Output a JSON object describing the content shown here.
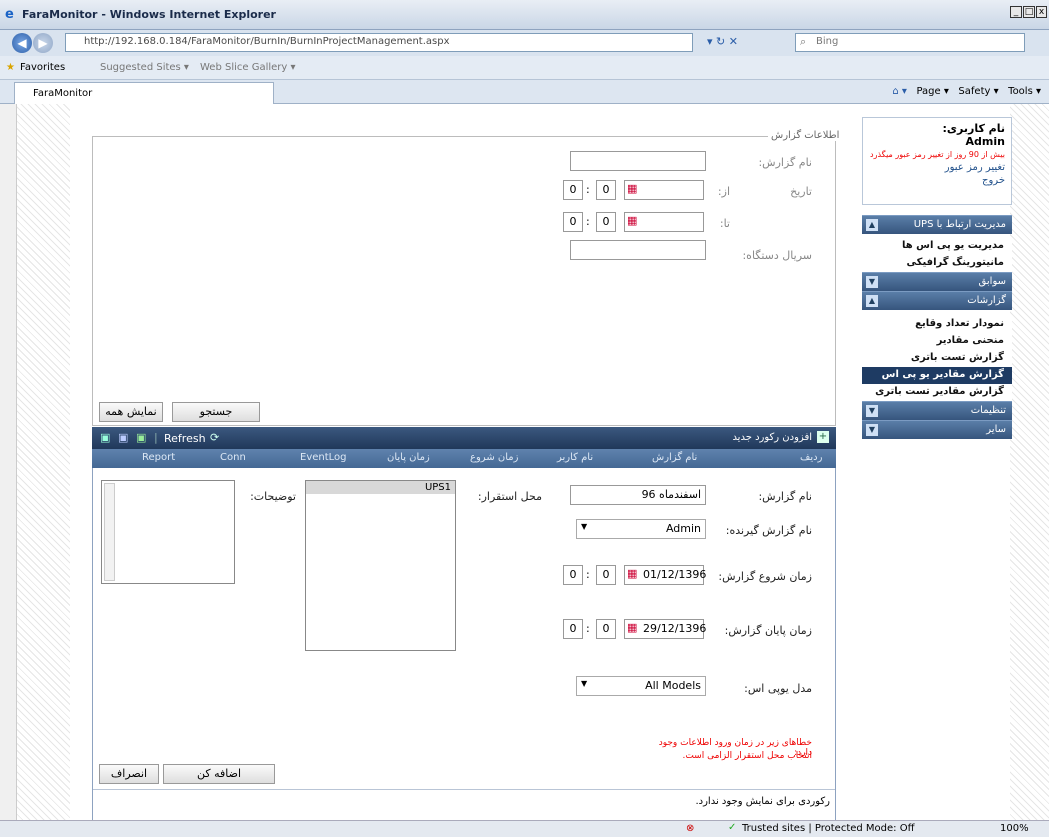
{
  "browser": {
    "title": "FaraMonitor - Windows Internet Explorer",
    "url": "http://192.168.0.184/FaraMonitor/BurnIn/BurnInProjectManagement.aspx",
    "search_placeholder": "Bing",
    "favorites_label": "Favorites",
    "fav_links": [
      "Suggested Sites ▾",
      "Web Slice Gallery ▾"
    ],
    "tab_label": "FaraMonitor",
    "tools": [
      "Page ▾",
      "Safety ▾",
      "Tools ▾"
    ],
    "status": "Trusted sites | Protected Mode: Off",
    "zoom": "100%"
  },
  "user": {
    "label": "نام کاربری:",
    "name": "Admin",
    "warning": "بیش از 90 روز از تغییر رمز عبور میگذرد",
    "change_password": "تغییر رمز عبور",
    "logout": "خروج"
  },
  "menu": [
    {
      "title": "مدیریت ارتباط با UPS",
      "items": [
        "مدیریت یو پی اس ها",
        "مانیتورینگ گرافیکی"
      ]
    },
    {
      "title": "سوابق",
      "items": []
    },
    {
      "title": "گزارشات",
      "items": [
        "نمودار تعداد وقایع",
        "منحنی مقادیر",
        "گزارش تست باتری",
        "گزارش مقادیر یو پی اس",
        "گزارش مقادیر تست باتری"
      ]
    },
    {
      "title": "تنظیمات",
      "items": []
    },
    {
      "title": "سایر",
      "items": []
    }
  ],
  "search_panel": {
    "legend": "اطلاعات گزارش",
    "report_name_label": "نام گزارش:",
    "date_label": "تاریخ",
    "from_label": "از:",
    "to_label": "تا:",
    "serial_label": "سریال دستگاه:",
    "zero": "0",
    "search_button": "جستجو",
    "show_all_button": "نمایش همه"
  },
  "grid": {
    "add_record": "افزودن رکورد جدید",
    "refresh": "Refresh",
    "columns": [
      "ردیف",
      "نام گزارش",
      "نام کاربر",
      "زمان شروع",
      "زمان پایان",
      "EventLog",
      "Conn",
      "Report"
    ],
    "empty_message": "رکوردی برای نمایش وجود ندارد."
  },
  "form": {
    "report_name_label": "نام گزارش:",
    "report_name_value": "اسفندماه 96",
    "recipient_label": "نام گزارش گیرنده:",
    "recipient_value": "Admin",
    "start_label": "زمان شروع گزارش:",
    "start_date": "01/12/1396",
    "end_label": "زمان پایان گزارش:",
    "end_date": "29/12/1396",
    "model_label": "مدل یوپی اس:",
    "model_value": "All Models",
    "location_label": "محل استقرار:",
    "location_item": "UPS1",
    "notes_label": "توضیحات:",
    "errors_title": "خطاهای زیر در زمان ورود اطلاعات وجود دارد:",
    "error_1": "انتخاب محل استقرار الزامی است.",
    "add_button": "اضافه کن",
    "cancel_button": "انصراف"
  }
}
